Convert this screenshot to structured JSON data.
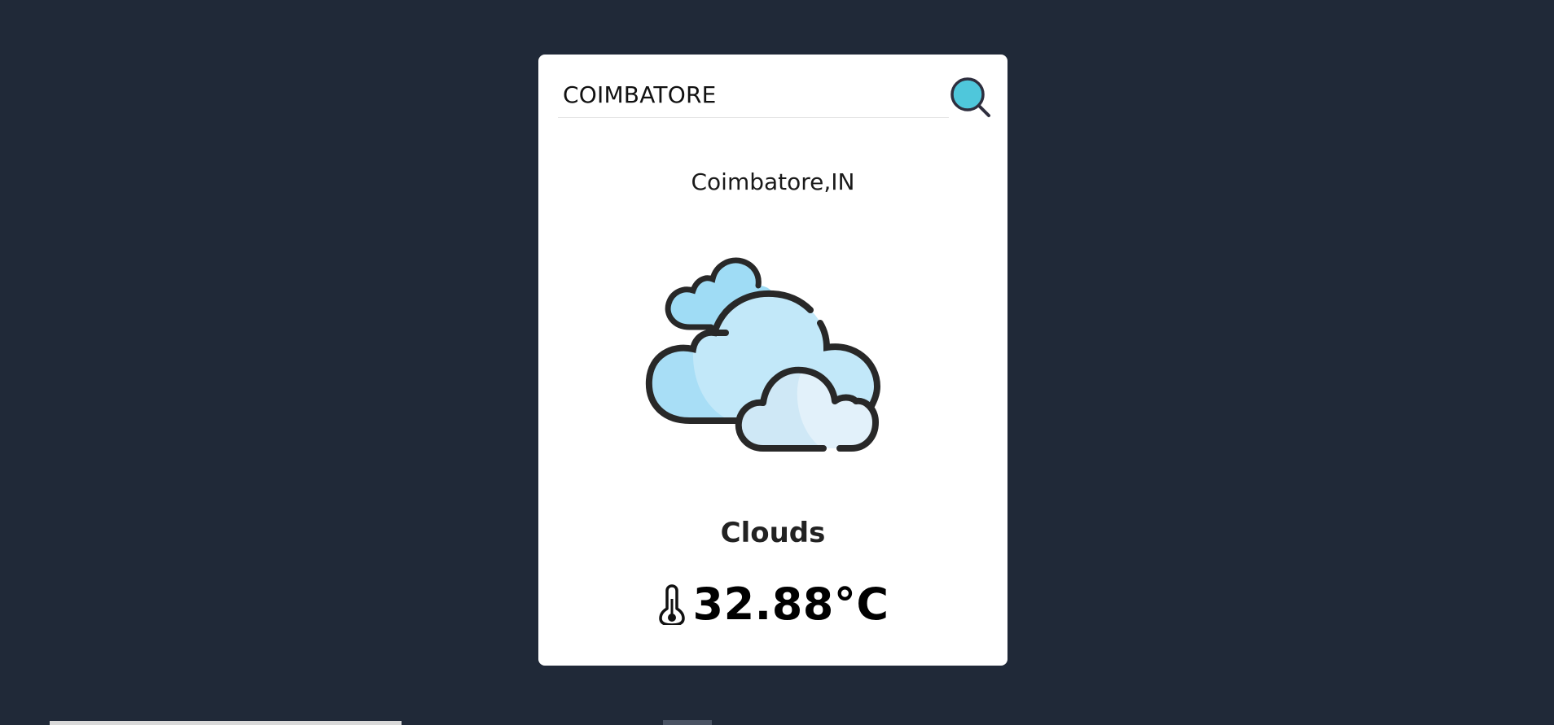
{
  "search": {
    "value": "COIMBATORE",
    "icon": "search-icon"
  },
  "weather": {
    "location": "Coimbatore,IN",
    "icon": "clouds-icon",
    "condition": "Clouds",
    "temperature": "32.88°C",
    "temperature_icon": "thermometer-icon"
  },
  "colors": {
    "background": "#202938",
    "card": "#ffffff",
    "search_icon_fill": "#4fc7db",
    "cloud_light": "#c2e8f9",
    "cloud_back": "#9fdcf5",
    "cloud_front": "#e2f1fa",
    "outline": "#282828"
  }
}
